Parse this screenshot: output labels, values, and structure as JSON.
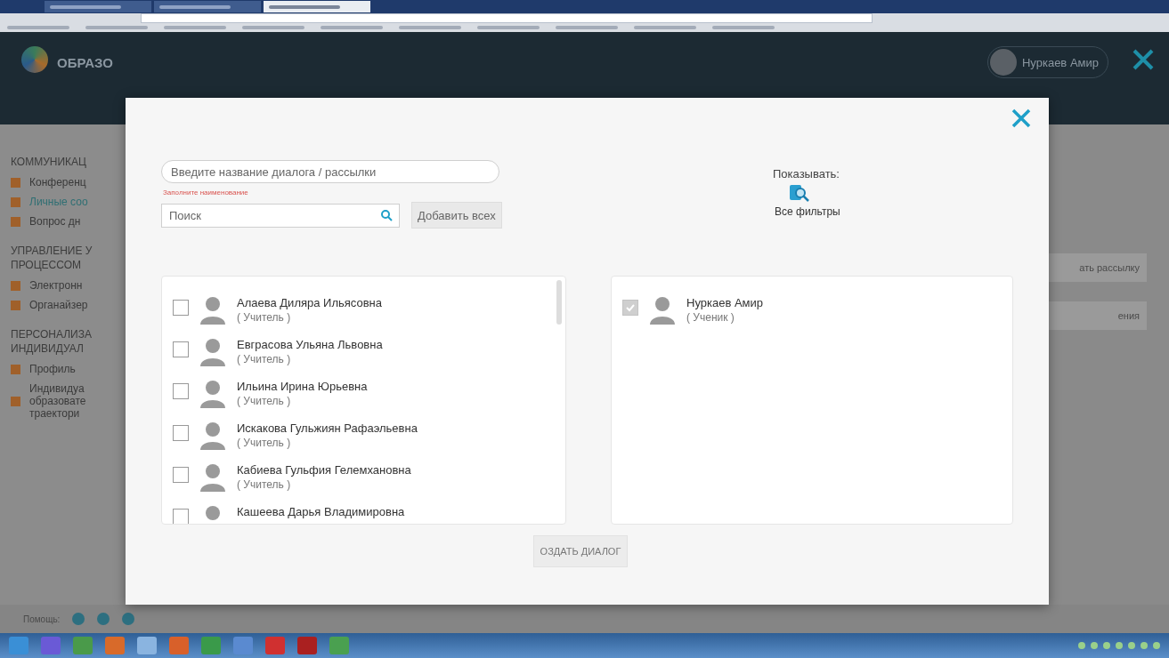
{
  "browser": {
    "tabs": [
      {
        "selected": false
      },
      {
        "selected": false
      },
      {
        "selected": true
      }
    ]
  },
  "app": {
    "header": {
      "logo_text": "ОБРАЗО",
      "user_name": "Нуркаев Амир"
    },
    "sidebar": [
      {
        "title": "КОММУНИКАЦ",
        "items": [
          {
            "label": "Конференц",
            "selected": false
          },
          {
            "label": "Личные соо",
            "selected": true
          },
          {
            "label": "Вопрос дн",
            "selected": false
          }
        ]
      },
      {
        "title": "УПРАВЛЕНИЕ У ПРОЦЕССОМ",
        "items": [
          {
            "label": "Электронн",
            "selected": false
          },
          {
            "label": "Органайзер",
            "selected": false
          }
        ]
      },
      {
        "title": "ПЕРСОНАЛИЗА ИНДИВИДУАЛ",
        "items": [
          {
            "label": "Профиль",
            "selected": false
          },
          {
            "label": "Индивидуа образовате траектори",
            "selected": false
          }
        ]
      }
    ],
    "right_buttons": [
      "ать рассылку",
      "ения"
    ],
    "footer": {
      "label": "Помощь:"
    }
  },
  "modal": {
    "dialog_name": {
      "placeholder": "Введите название диалога / рассылки"
    },
    "hint": "Заполните наименование",
    "search": {
      "placeholder": "Поиск"
    },
    "add_all_button": "Добавить всех",
    "filter": {
      "label": "Показывать:",
      "button": "Все фильтры"
    },
    "available": [
      {
        "name": "Алаева Диляра Ильясовна",
        "role": "( Учитель )",
        "checked": false,
        "disabled": false
      },
      {
        "name": "Евграсова Ульяна Львовна",
        "role": "( Учитель )",
        "checked": false,
        "disabled": false
      },
      {
        "name": "Ильина Ирина Юрьевна",
        "role": "( Учитель )",
        "checked": false,
        "disabled": false
      },
      {
        "name": "Искакова Гульжиян Рафаэльевна",
        "role": "( Учитель )",
        "checked": false,
        "disabled": false
      },
      {
        "name": "Кабиева Гульфия Гелемхановна",
        "role": "( Учитель )",
        "checked": false,
        "disabled": false
      },
      {
        "name": "Кашеева Дарья Владимировна",
        "checked": false,
        "disabled": false
      }
    ],
    "chosen": [
      {
        "name": "Нуркаев Амир",
        "role": "( Ученик )",
        "checked": true,
        "disabled": true
      }
    ],
    "create_button": "ОЗДАТЬ ДИАЛОГ"
  }
}
